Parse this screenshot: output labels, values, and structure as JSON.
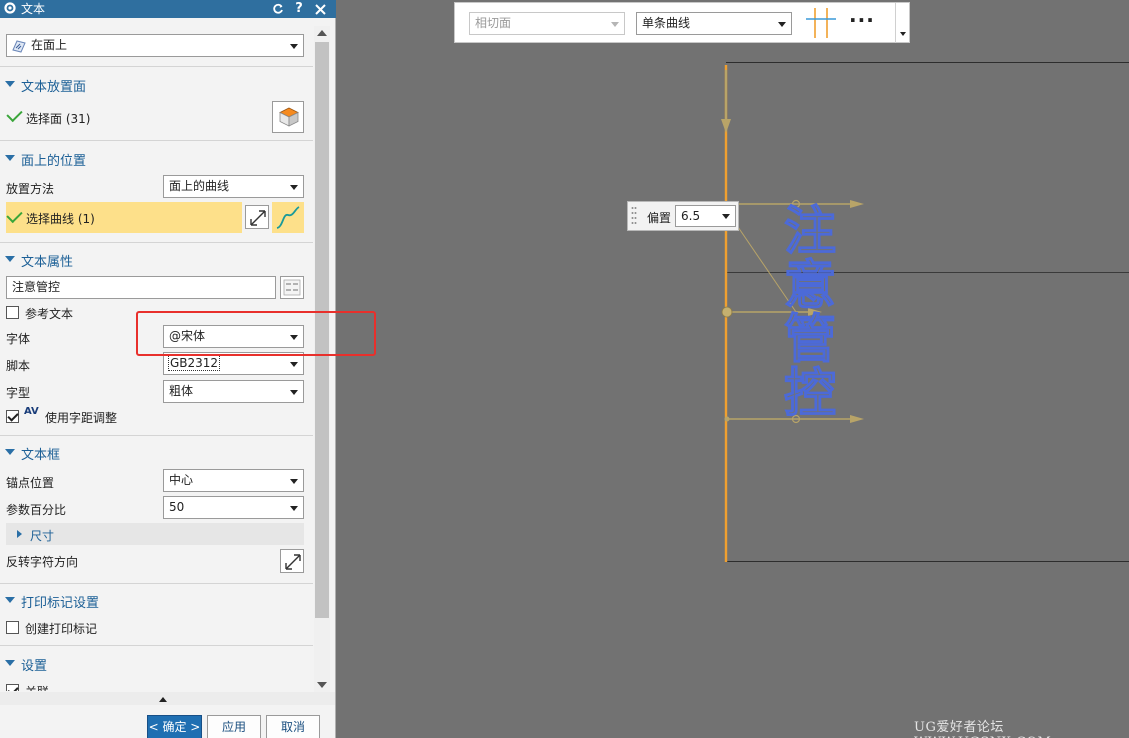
{
  "dialog": {
    "title": "文本",
    "type_select": "在面上",
    "placement_face": {
      "header": "文本放置面",
      "select_label": "选择面 (31)"
    },
    "position_on_face": {
      "header": "面上的位置",
      "method_label": "放置方法",
      "method_value": "面上的曲线",
      "select_curve_label": "选择曲线 (1)"
    },
    "text_props": {
      "header": "文本属性",
      "text_value": "注意管控",
      "ref_text_label": "参考文本",
      "font_label": "字体",
      "font_value": "@宋体",
      "script_label": "脚本",
      "script_value": "GB2312",
      "style_label": "字型",
      "style_value": "粗体",
      "kerning_label": "使用字距调整",
      "kerning_icon_text": "AV"
    },
    "text_box": {
      "header": "文本框",
      "anchor_label": "锚点位置",
      "anchor_value": "中心",
      "param_label": "参数百分比",
      "param_value": "50",
      "size_label": "尺寸",
      "reverse_label": "反转字符方向"
    },
    "print_mark": {
      "header": "打印标记设置",
      "create_label": "创建打印标记"
    },
    "settings": {
      "header": "设置",
      "assoc_label": "关联"
    },
    "buttons": {
      "ok": "< 确定 >",
      "apply": "应用",
      "cancel": "取消"
    }
  },
  "toolbar": {
    "tangent_select": "相切面",
    "curve_select": "单条曲线",
    "more": "···"
  },
  "graphics": {
    "offset_label": "偏置",
    "offset_value": "6.5",
    "preview_chars": [
      "注",
      "意",
      "管",
      "控"
    ],
    "watermark": "UG爱好者论坛 WWW.UGSNX.COM"
  },
  "colors": {
    "title_bar": "#2f6f9f",
    "section_header": "#1b5f96",
    "highlight_row": "#fde08a",
    "curve_orange": "#f0a030",
    "preview_text": "#4c6ad8",
    "annotation_red": "#e8302c",
    "background_gray": "#727272"
  }
}
